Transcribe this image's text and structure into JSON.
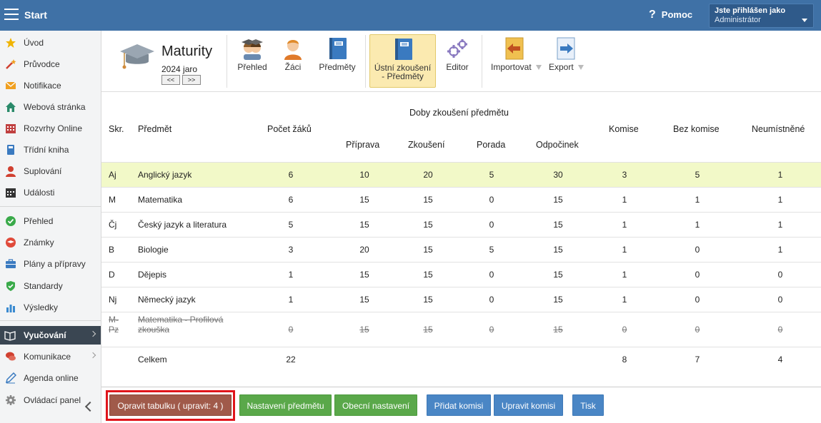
{
  "topbar": {
    "start": "Start",
    "help": "Pomoc",
    "user_line1": "Jste přihlášen jako",
    "user_line2": "Administrátor"
  },
  "sidebar": {
    "items": [
      {
        "label": "Úvod",
        "icon": "star-icon",
        "color": "#f0b400"
      },
      {
        "label": "Průvodce",
        "icon": "magic-wand-icon",
        "color": "#d04030"
      },
      {
        "label": "Notifikace",
        "icon": "envelope-icon",
        "color": "#f0a020"
      },
      {
        "label": "Webová stránka",
        "icon": "home-icon",
        "color": "#2a8a6a"
      },
      {
        "label": "Rozvrhy Online",
        "icon": "calendar-grid-icon",
        "color": "#c04040"
      },
      {
        "label": "Třídní kniha",
        "icon": "book-icon",
        "color": "#3a7ac0"
      },
      {
        "label": "Suplování",
        "icon": "person-icon",
        "color": "#d04030"
      },
      {
        "label": "Události",
        "icon": "calendar-icon",
        "color": "#333333"
      },
      {
        "label": "Přehled",
        "icon": "check-circle-icon",
        "color": "#3aaa4a"
      },
      {
        "label": "Známky",
        "icon": "graduation-badge-icon",
        "color": "#e04a3a"
      },
      {
        "label": "Plány a přípravy",
        "icon": "briefcase-icon",
        "color": "#3a7ac0"
      },
      {
        "label": "Standardy",
        "icon": "shield-check-icon",
        "color": "#3aaa4a"
      },
      {
        "label": "Výsledky",
        "icon": "bar-chart-icon",
        "color": "#3a8ad0"
      },
      {
        "label": "Vyučování",
        "icon": "open-book-icon",
        "color": "#ffffff"
      },
      {
        "label": "Komunikace",
        "icon": "chat-icon",
        "color": "#d04030"
      },
      {
        "label": "Agenda online",
        "icon": "pencil-icon",
        "color": "#3a7ac0"
      },
      {
        "label": "Ovládací panel",
        "icon": "gear-icon",
        "color": "#888888"
      }
    ]
  },
  "toolbar": {
    "title": "Maturity",
    "term": "2024 jaro",
    "prev": "<<",
    "next": ">>",
    "buttons": [
      {
        "label": "Přehled",
        "icon": "students-group-icon"
      },
      {
        "label": "Žáci",
        "icon": "student-icon"
      },
      {
        "label": "Předměty",
        "icon": "notebook-icon"
      },
      {
        "label": "Ústní zkoušení\n- Předměty",
        "icon": "notebook-icon"
      },
      {
        "label": "Editor",
        "icon": "gears-icon"
      },
      {
        "label": "Importovat",
        "icon": "import-arrow-icon"
      },
      {
        "label": "Export",
        "icon": "export-arrow-icon"
      }
    ]
  },
  "table": {
    "headers": {
      "skr": "Skr.",
      "predmet": "Předmět",
      "pocet": "Počet žáků",
      "doby": "Doby zkoušení předmětu",
      "priprava": "Příprava",
      "zkouseni": "Zkoušení",
      "porada": "Porada",
      "odpocinek": "Odpočinek",
      "komise": "Komise",
      "bez": "Bez komise",
      "neum": "Neumístněné"
    },
    "rows": [
      {
        "skr": "Aj",
        "name": "Anglický jazyk",
        "pocet": "6",
        "pri": "10",
        "zk": "20",
        "por": "5",
        "odp": "30",
        "kom": "3",
        "bez": "5",
        "neu": "1"
      },
      {
        "skr": "M",
        "name": "Matematika",
        "pocet": "6",
        "pri": "15",
        "zk": "15",
        "por": "0",
        "odp": "15",
        "kom": "1",
        "bez": "1",
        "neu": "1"
      },
      {
        "skr": "Čj",
        "name": "Český jazyk a literatura",
        "pocet": "5",
        "pri": "15",
        "zk": "15",
        "por": "0",
        "odp": "15",
        "kom": "1",
        "bez": "1",
        "neu": "1"
      },
      {
        "skr": "B",
        "name": "Biologie",
        "pocet": "3",
        "pri": "20",
        "zk": "15",
        "por": "5",
        "odp": "15",
        "kom": "1",
        "bez": "0",
        "neu": "1"
      },
      {
        "skr": "D",
        "name": "Dějepis",
        "pocet": "1",
        "pri": "15",
        "zk": "15",
        "por": "0",
        "odp": "15",
        "kom": "1",
        "bez": "0",
        "neu": "0"
      },
      {
        "skr": "Nj",
        "name": "Německý jazyk",
        "pocet": "1",
        "pri": "15",
        "zk": "15",
        "por": "0",
        "odp": "15",
        "kom": "1",
        "bez": "0",
        "neu": "0"
      },
      {
        "skr": "M-Pz",
        "skr1": "M-",
        "skr2": "Pz",
        "name1": "Matematika - Profilová",
        "name2": "zkouška",
        "pocet": "0",
        "pri": "15",
        "zk": "15",
        "por": "0",
        "odp": "15",
        "kom": "0",
        "bez": "0",
        "neu": "0"
      }
    ],
    "total": {
      "label": "Celkem",
      "pocet": "22",
      "kom": "8",
      "bez": "7",
      "neu": "4"
    }
  },
  "footer": {
    "opravit": "Opravit tabulku ( upravit: 4 )",
    "nastaveni": "Nastavení předmětu",
    "obecni": "Obecní nastavení",
    "pridat": "Přidat komisi",
    "upravit": "Upravit komisi",
    "tisk": "Tisk"
  }
}
